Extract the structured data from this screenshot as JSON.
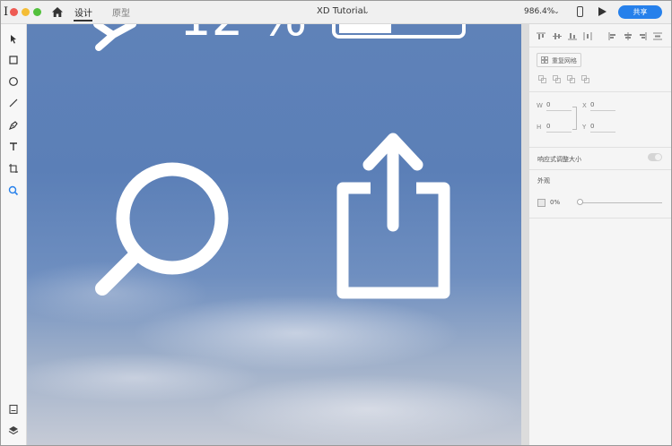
{
  "titlebar": {
    "tabs": {
      "design": "设计",
      "prototype": "原型"
    },
    "document_title": "XD Tutorial",
    "document_chevron": "⌄",
    "zoom": "986.4%",
    "zoom_chevron": "⌄",
    "share_label": "共享",
    "cursor_glyph": "I",
    "icons": [
      "home-icon",
      "device-preview-icon",
      "play-icon"
    ]
  },
  "toolbar": {
    "tools": [
      "select-tool-icon",
      "rectangle-tool-icon",
      "ellipse-tool-icon",
      "line-tool-icon",
      "pen-tool-icon",
      "text-tool-icon",
      "artboard-tool-icon",
      "zoom-tool-icon"
    ],
    "bottom": [
      "assets-icon",
      "layers-icon"
    ]
  },
  "canvas": {
    "visible_text": {
      "partial_digits": "12 %"
    },
    "icons": [
      "status-bar-signal-icon",
      "battery-icon",
      "search-icon",
      "share-icon"
    ]
  },
  "properties": {
    "repeat_grid_label": "重复网格",
    "fields": {
      "w_label": "W",
      "w_value": "0",
      "h_label": "H",
      "h_value": "0",
      "x_label": "X",
      "x_value": "0",
      "y_label": "Y",
      "y_value": "0"
    },
    "responsive_resize_label": "响应式调整大小",
    "appearance_label": "外观",
    "opacity_value": "0%"
  },
  "colors": {
    "accent": "#2680eb",
    "traffic_red": "#ee5b54",
    "traffic_yellow": "#f4bd36",
    "traffic_green": "#52c03c",
    "canvas_sky": "#5b7fb7"
  }
}
